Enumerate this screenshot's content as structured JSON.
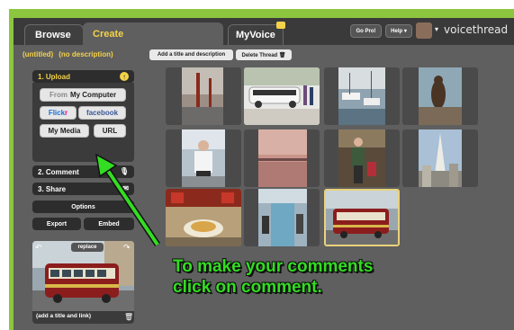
{
  "tabs": [
    {
      "label": "Browse"
    },
    {
      "label": "Create"
    },
    {
      "label": "MyVoice"
    }
  ],
  "topbar": {
    "gopro_label": "Go Pro!",
    "help_label": "Help ▾",
    "avatar_caret": "▾",
    "brand": "voicethread"
  },
  "thread": {
    "title": "(untitled)",
    "description": "(no description)",
    "add_title_label": "Add a title and description",
    "delete_label": "Delete Thread 🗑"
  },
  "sidebar": {
    "upload": {
      "label": "1. Upload",
      "from_prefix": "From",
      "from_computer": "My Computer",
      "flickr_a": "Flick",
      "flickr_b": "r",
      "facebook": "facebook",
      "my_media": "My Media",
      "url": "URL"
    },
    "comment_label": "2. Comment",
    "share_label": "3. Share",
    "options_label": "Options",
    "export_label": "Export",
    "embed_label": "Embed",
    "preview": {
      "replace_label": "replace",
      "caption": "(add a title and link)"
    }
  },
  "annotation": {
    "line1": "To make your comments",
    "line2": "click on comment."
  },
  "colors": {
    "accent_yellow": "#f4d24a",
    "frame_green": "#8cc63f",
    "annotation_green": "#33dd22"
  }
}
